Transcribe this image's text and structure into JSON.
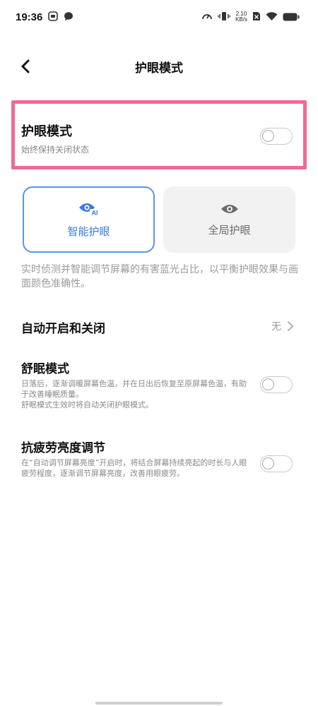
{
  "status_bar": {
    "time": "19:36",
    "net_speed_value": "2.10",
    "net_speed_unit": "KB/s"
  },
  "header": {
    "title": "护眼模式"
  },
  "main_toggle": {
    "title": "护眼模式",
    "subtitle": "始终保持关闭状态",
    "enabled": false
  },
  "modes": [
    {
      "label": "智能护眼",
      "icon": "eye-ai-icon",
      "selected": true
    },
    {
      "label": "全局护眼",
      "icon": "eye-icon",
      "selected": false
    }
  ],
  "mode_description": "实时侦测并智能调节屏幕的有害蓝光占比，以平衡护眼效果与画面颜色准确性。",
  "schedule": {
    "title": "自动开启和关闭",
    "value": "无"
  },
  "sleep_mode": {
    "title": "舒眠模式",
    "description": "日落后，逐渐调暖屏幕色温，并在日出后恢复至原屏幕色温，有助于改善睡眠质量。\n舒眠模式生效时将自动关闭护眼模式。",
    "enabled": false
  },
  "anti_fatigue": {
    "title": "抗疲劳亮度调节",
    "description": "在“自动调节屏幕亮度”开启时，将结合屏幕持续亮起的时长与人眼疲劳程度，逐渐调节屏幕亮度，改善用眼疲劳。",
    "enabled": false
  },
  "colors": {
    "accent": "#3a7be0",
    "highlight": "#ee6b94",
    "card_inactive_bg": "#f2f2f2"
  }
}
